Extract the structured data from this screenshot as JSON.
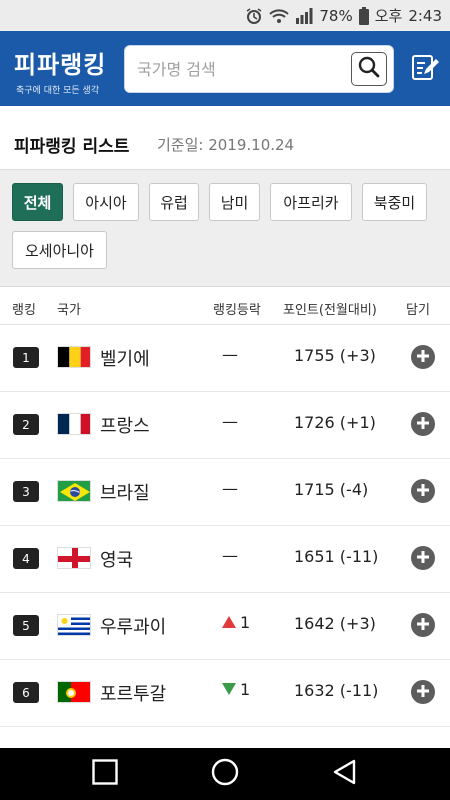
{
  "status": {
    "battery": "78%",
    "ampm": "오후",
    "time": "2:43",
    "icons": [
      "alarm-icon",
      "wifi-icon",
      "signal-icon",
      "battery-icon"
    ]
  },
  "header": {
    "title": "피파랭킹",
    "subtitle": "축구에 대한 모든 생각",
    "search_placeholder": "국가명 검색",
    "search_value": "",
    "brand_color": "#1b5aa8"
  },
  "page": {
    "title": "피파랭킹 리스트",
    "base_date": "기준일: 2019.10.24"
  },
  "filters": [
    "전체",
    "아시아",
    "유럽",
    "남미",
    "아프리카",
    "북중미",
    "오세아니아"
  ],
  "active_filter": "전체",
  "table": {
    "headers": {
      "rank": "랭킹",
      "country": "국가",
      "change": "랭킹등락",
      "points": "포인트(전월대비)",
      "save": "담기"
    },
    "rows": [
      {
        "rank": "1",
        "country": "벨기에",
        "flag": "belgium",
        "change_dir": "same",
        "change": "—",
        "points": "1755 (+3)"
      },
      {
        "rank": "2",
        "country": "프랑스",
        "flag": "france",
        "change_dir": "same",
        "change": "—",
        "points": "1726 (+1)"
      },
      {
        "rank": "3",
        "country": "브라질",
        "flag": "brazil",
        "change_dir": "same",
        "change": "—",
        "points": "1715 (-4)"
      },
      {
        "rank": "4",
        "country": "영국",
        "flag": "england",
        "change_dir": "same",
        "change": "—",
        "points": "1651 (-11)"
      },
      {
        "rank": "5",
        "country": "우루과이",
        "flag": "uruguay",
        "change_dir": "up",
        "change": "1",
        "points": "1642 (+3)"
      },
      {
        "rank": "6",
        "country": "포르투갈",
        "flag": "portugal",
        "change_dir": "down",
        "change": "1",
        "points": "1632 (-11)"
      }
    ]
  },
  "colors": {
    "active_chip": "#1e6e58",
    "up": "#e03b3b",
    "down": "#3a9a4a"
  }
}
